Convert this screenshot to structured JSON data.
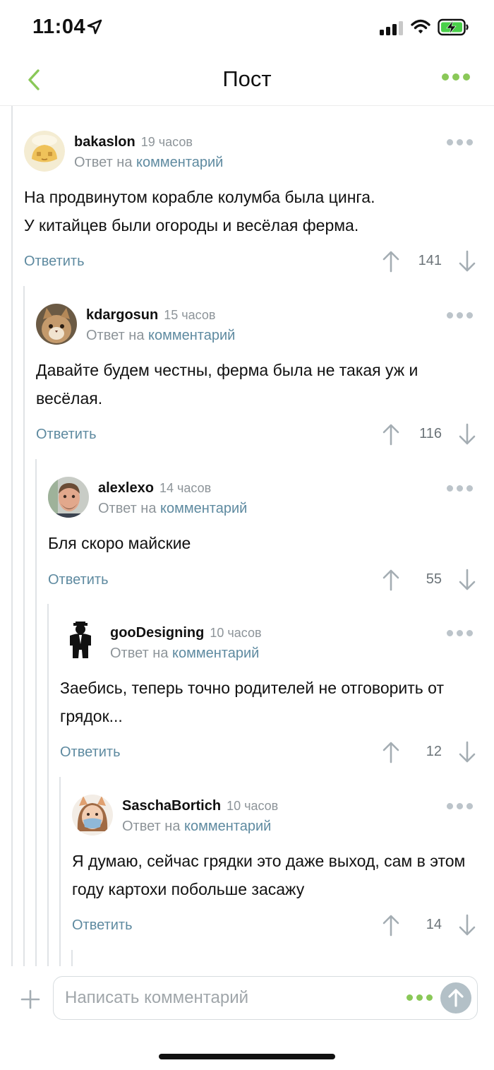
{
  "status_bar": {
    "time": "11:04",
    "icons": [
      "location-arrow-icon",
      "cellular-signal-icon",
      "wifi-icon",
      "battery-charging-icon"
    ]
  },
  "nav": {
    "title": "Пост",
    "back_icon": "chevron-left-icon",
    "more_icon": "more-dots-icon",
    "accent_color": "#8ac858"
  },
  "comments": [
    {
      "author": "bakaslon",
      "ago": "19 часов",
      "reply_prefix": "Ответ на",
      "reply_link": "комментарий",
      "text": "На продвинутом корабле колумба была цинга.\nУ китайцев были огороды и весёлая ферма.",
      "reply_label": "Ответить",
      "score": "141"
    },
    {
      "author": "kdargosun",
      "ago": "15 часов",
      "reply_prefix": "Ответ на",
      "reply_link": "комментарий",
      "text": "Давайте будем честны, ферма была не такая уж и весёлая.",
      "reply_label": "Ответить",
      "score": "116"
    },
    {
      "author": "alexlexo",
      "ago": "14 часов",
      "reply_prefix": "Ответ на",
      "reply_link": "комментарий",
      "text": "Бля скоро майские",
      "reply_label": "Ответить",
      "score": "55"
    },
    {
      "author": "gooDesigning",
      "ago": "10 часов",
      "reply_prefix": "Ответ на",
      "reply_link": "комментарий",
      "text": "Заебись, теперь точно родителей не отговорить от грядок...",
      "reply_label": "Ответить",
      "score": "12"
    },
    {
      "author": "SaschaBortich",
      "ago": "10 часов",
      "reply_prefix": "Ответ на",
      "reply_link": "комментарий",
      "text": "Я думаю, сейчас грядки это даже выход, сам в этом году картохи побольше засажу",
      "reply_label": "Ответить",
      "score": "14"
    }
  ],
  "colors": {
    "link": "#5e8aa0",
    "muted": "#8d9499",
    "thread_line": "#e0e3e6",
    "accent": "#8ac858"
  },
  "compose": {
    "placeholder": "Написать комментарий",
    "plus_icon": "plus-icon",
    "send_icon": "send-arrow-up-icon"
  }
}
